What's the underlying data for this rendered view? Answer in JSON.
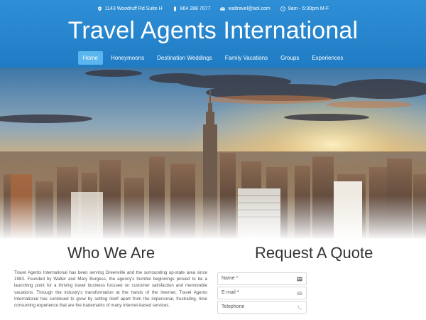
{
  "contact": {
    "address": "1143 Woodruff Rd Suite H",
    "phone": "864 288 7077",
    "email": "waltravel@aol.com",
    "hours": "9am - 5:30pm M-F"
  },
  "site_title": "Travel Agents International",
  "nav": [
    {
      "label": "Home",
      "active": true
    },
    {
      "label": "Honeymoons",
      "active": false
    },
    {
      "label": "Destination Weddings",
      "active": false
    },
    {
      "label": "Family Vacations",
      "active": false
    },
    {
      "label": "Groups",
      "active": false
    },
    {
      "label": "Experiences",
      "active": false
    }
  ],
  "who": {
    "title": "Who We Are",
    "body": "Travel Agents International has been serving Greenville and the surrounding up-state area since 1983. Founded by Walter and Mary Burgess, the agency's humble beginnings proved to be a launching point for a thriving travel business focused on customer satisfaction and memorable vacations. Through the industry's transformation at the hands of the Internet, Travel Agents International has continued to grow by setting itself apart from the impersonal, frustrating, time consuming experience that are the trademarks of many Internet-based services."
  },
  "quote": {
    "title": "Request A Quote",
    "fields": [
      {
        "placeholder": "Name *",
        "icon": "id-card-icon"
      },
      {
        "placeholder": "E-mail *",
        "icon": "envelope-icon"
      },
      {
        "placeholder": "Telephone",
        "icon": "phone-icon"
      }
    ]
  },
  "colors": {
    "header": "#1f7cc4",
    "nav_active": "#5bb5ee"
  }
}
